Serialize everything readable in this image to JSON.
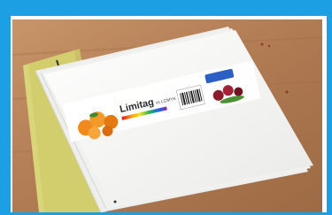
{
  "photo": {
    "subject": "Stack of mailing bags with product label",
    "label": {
      "brand": "Limitag",
      "suffix": "vs LCMYK"
    },
    "colors": {
      "frame": "#1c9fe3",
      "table": "#b07a52",
      "bag": "#f3f3f1",
      "yellow_bags": "#d9d67a",
      "orange": "#f08a1c"
    }
  }
}
